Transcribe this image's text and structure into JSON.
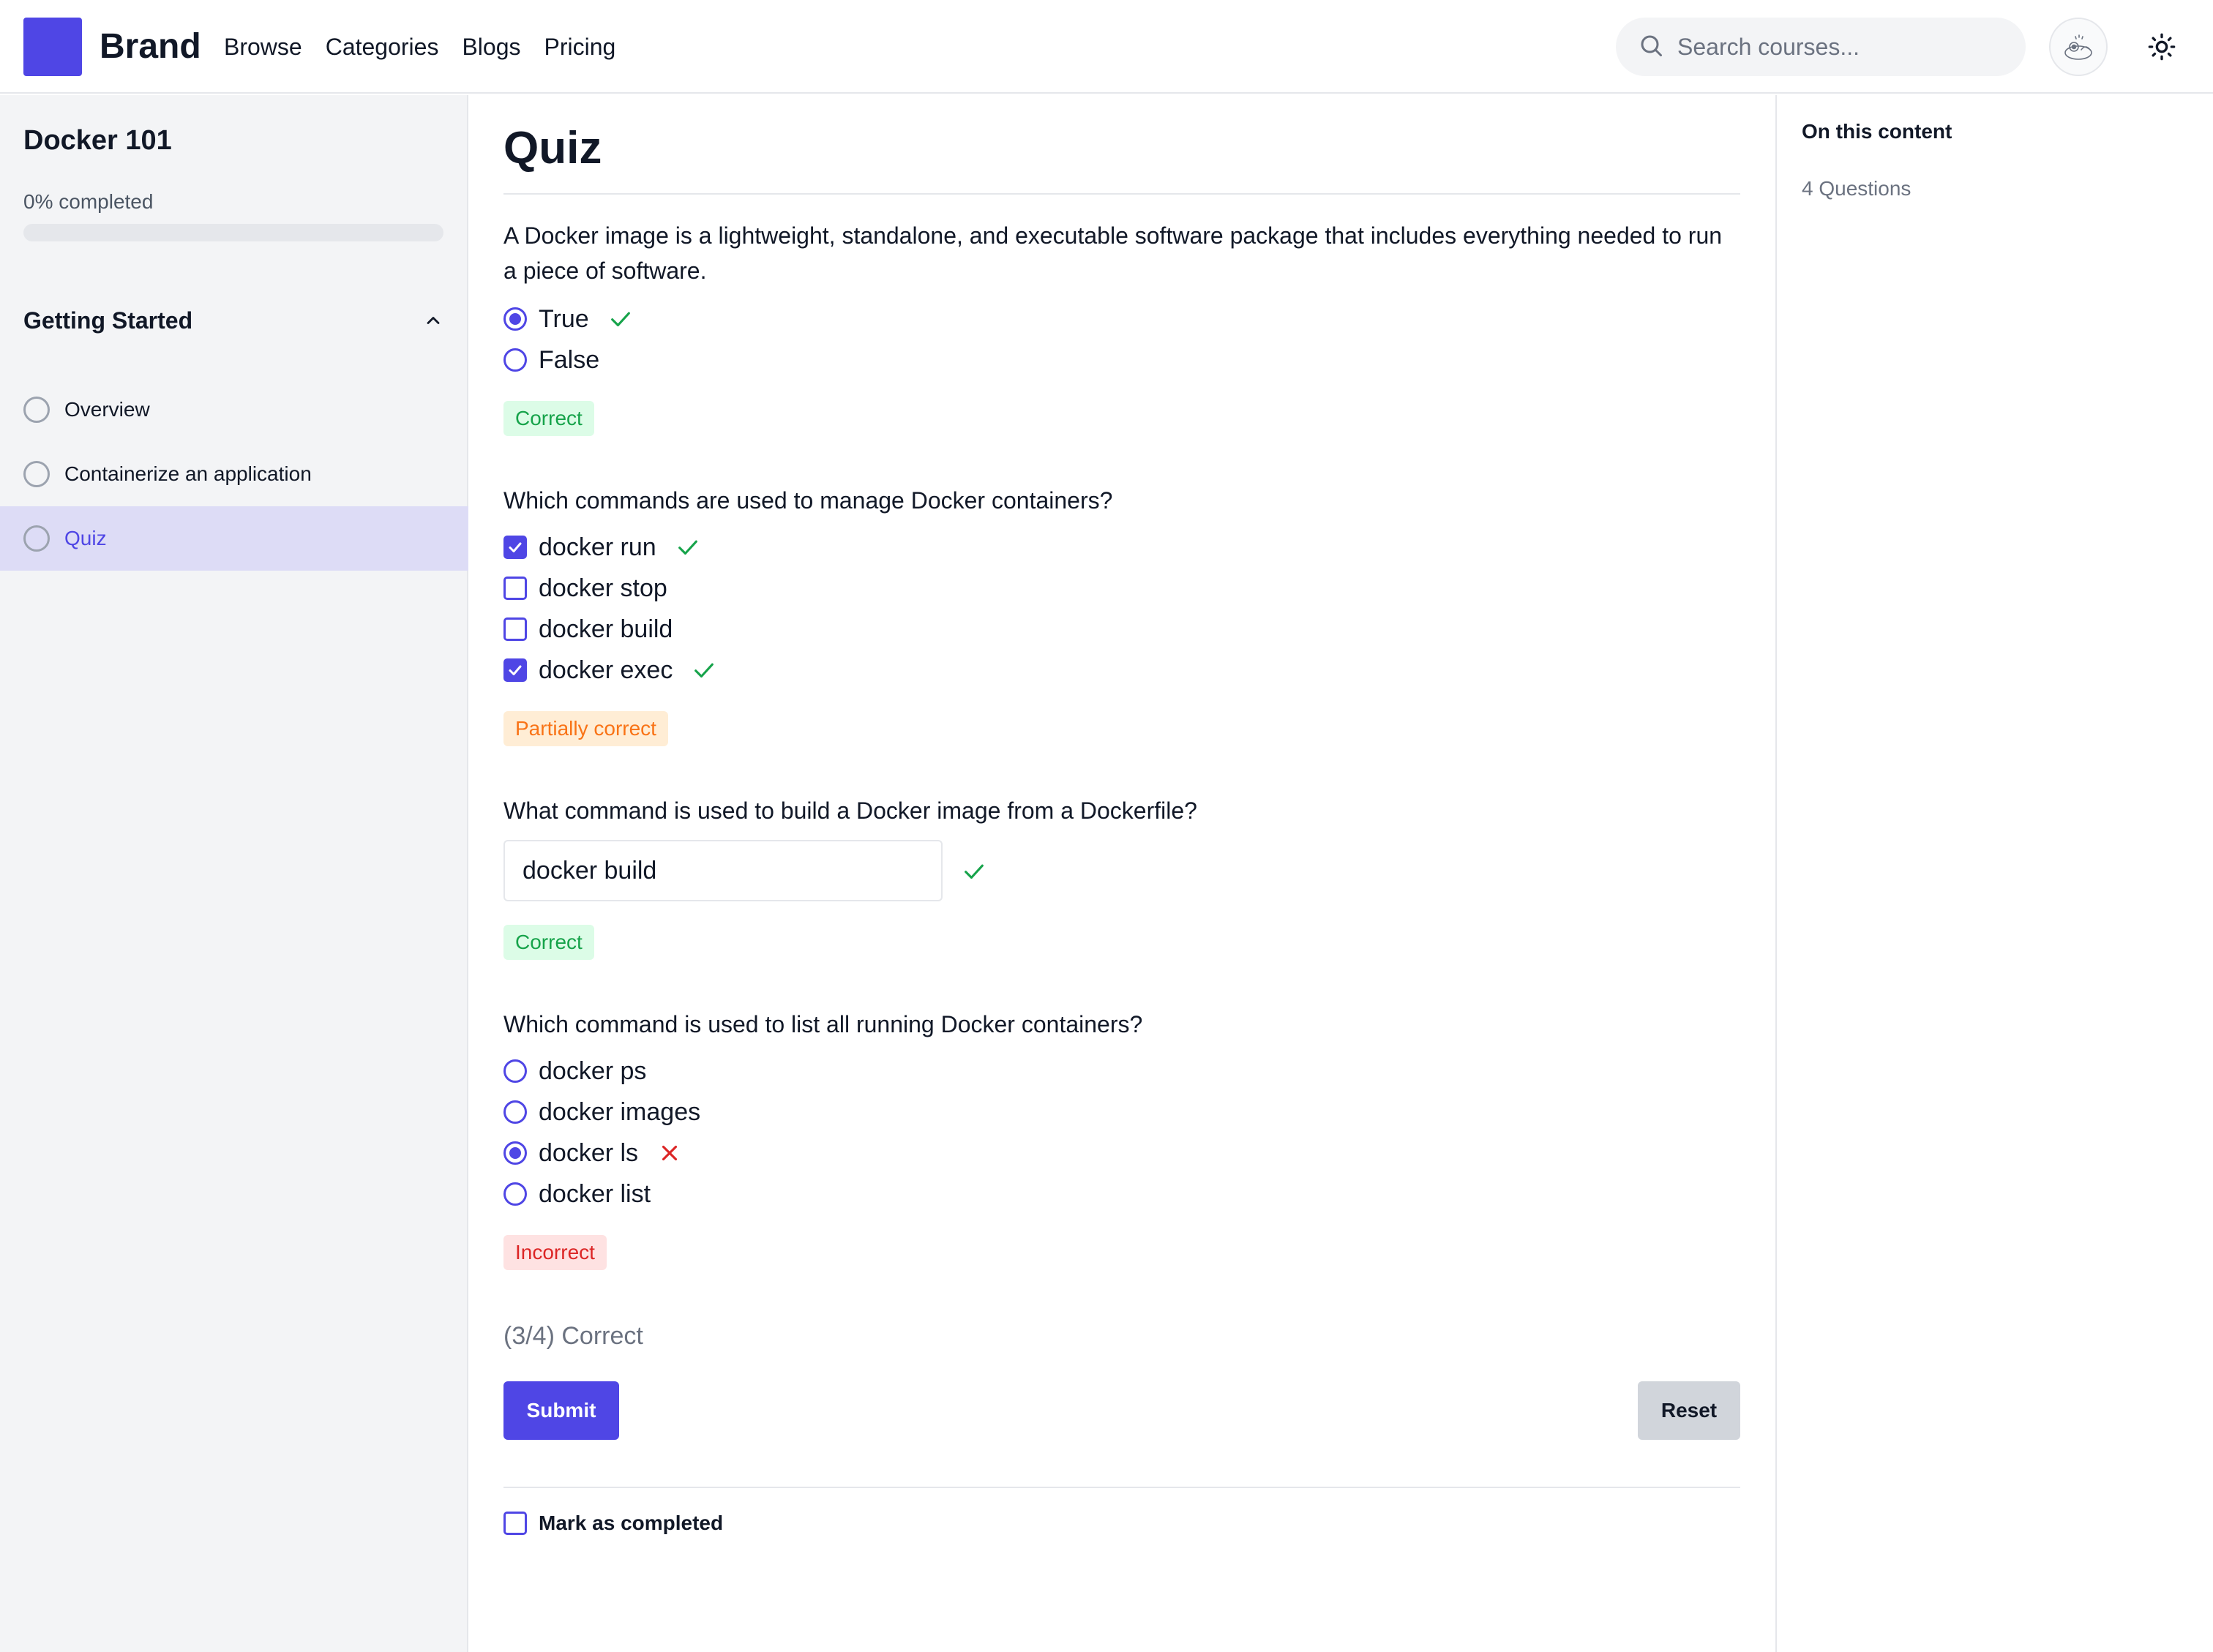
{
  "header": {
    "brand": "Brand",
    "nav": [
      "Browse",
      "Categories",
      "Blogs",
      "Pricing"
    ],
    "search_placeholder": "Search courses...",
    "avatar_icon": "user-avatar-icon",
    "theme_icon": "sun-icon"
  },
  "colors": {
    "accent": "#4f46e5",
    "correct": "#16a34a",
    "partial": "#f97316",
    "incorrect": "#dc2626",
    "sidebar_bg": "#f3f4f6",
    "active_item_bg": "#dddcf6"
  },
  "sidebar": {
    "course_title": "Docker 101",
    "progress_label": "0% completed",
    "progress_fraction": 0,
    "section_title": "Getting Started",
    "section_expanded": true,
    "items": [
      {
        "label": "Overview",
        "active": false
      },
      {
        "label": "Containerize an application",
        "active": false
      },
      {
        "label": "Quiz",
        "active": true
      }
    ]
  },
  "main": {
    "title": "Quiz",
    "questions": [
      {
        "text": "A Docker image is a lightweight, standalone, and executable software package that includes everything needed to run a piece of software.",
        "type": "radio",
        "options": [
          {
            "label": "True",
            "selected": true,
            "mark": "check"
          },
          {
            "label": "False",
            "selected": false,
            "mark": null
          }
        ],
        "result": "Correct"
      },
      {
        "text": "Which commands are used to manage Docker containers?",
        "type": "checkbox",
        "options": [
          {
            "label": "docker run",
            "selected": true,
            "mark": "check"
          },
          {
            "label": "docker stop",
            "selected": false,
            "mark": null
          },
          {
            "label": "docker build",
            "selected": false,
            "mark": null
          },
          {
            "label": "docker exec",
            "selected": true,
            "mark": "check"
          }
        ],
        "result": "Partially correct"
      },
      {
        "text": "What command is used to build a Docker image from a Dockerfile?",
        "type": "text",
        "answer": "docker build",
        "mark": "check",
        "result": "Correct"
      },
      {
        "text": "Which command is used to list all running Docker containers?",
        "type": "radio",
        "options": [
          {
            "label": "docker ps",
            "selected": false,
            "mark": null
          },
          {
            "label": "docker images",
            "selected": false,
            "mark": null
          },
          {
            "label": "docker ls",
            "selected": true,
            "mark": "cross"
          },
          {
            "label": "docker list",
            "selected": false,
            "mark": null
          }
        ],
        "result": "Incorrect"
      }
    ],
    "score": "(3/4) Correct",
    "submit_label": "Submit",
    "reset_label": "Reset",
    "mark_complete_label": "Mark as completed",
    "mark_complete_checked": false
  },
  "toc": {
    "title": "On this content",
    "items": [
      "4 Questions"
    ]
  }
}
